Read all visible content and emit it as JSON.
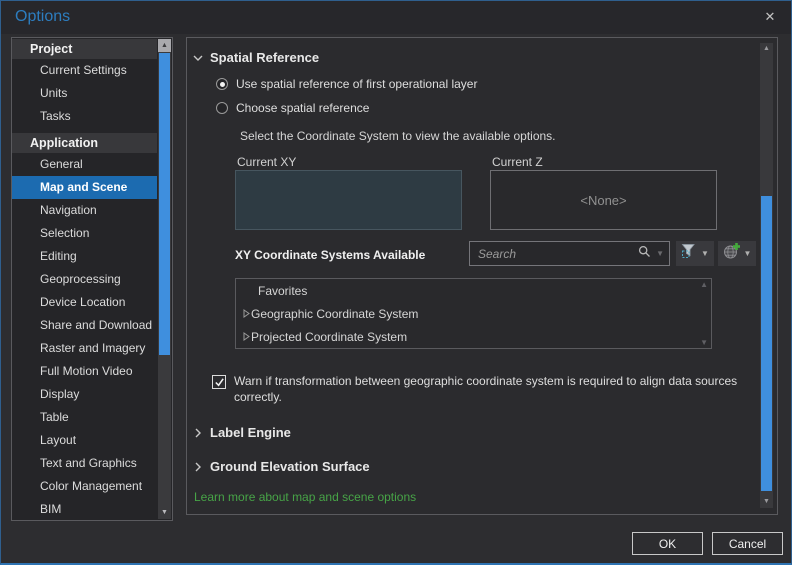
{
  "window": {
    "title": "Options",
    "ok_label": "OK",
    "cancel_label": "Cancel"
  },
  "icons": {
    "close": "✕",
    "scroll_up": "▲",
    "scroll_down": "▼",
    "dropdown": "▼"
  },
  "colors": {
    "selection_blue": "#1c6bb0",
    "scrollbar_blue": "#3f8fde",
    "title_blue": "#2d7dbf",
    "link_green": "#47a447",
    "current_xy_fill": "#2e3b43"
  },
  "sidebar": {
    "sections": [
      {
        "header": "Project",
        "items": [
          "Current Settings",
          "Units",
          "Tasks"
        ]
      },
      {
        "header": "Application",
        "selected_item": "Map and Scene",
        "items": [
          "General",
          "Map and Scene",
          "Navigation",
          "Selection",
          "Editing",
          "Geoprocessing",
          "Device Location",
          "Share and Download",
          "Raster and Imagery",
          "Full Motion Video",
          "Display",
          "Table",
          "Layout",
          "Text and Graphics",
          "Color Management",
          "BIM"
        ]
      }
    ]
  },
  "main": {
    "spatial_reference": {
      "title": "Spatial Reference",
      "use_first_layer": "Use spatial reference of first operational layer",
      "choose": "Choose spatial reference",
      "hint": "Select the Coordinate System to view the available options.",
      "current_xy_label": "Current XY",
      "current_z_label": "Current Z",
      "current_z_value": "<None>",
      "xy_available": "XY Coordinate Systems Available",
      "search_placeholder": "Search",
      "coordinate_list": [
        "Favorites",
        "Geographic Coordinate System",
        "Projected Coordinate System"
      ],
      "warn_checkbox": "Warn if transformation between geographic coordinate system is required to align data sources correctly.",
      "warn_checked": true
    },
    "collapsed_sections": [
      "Label Engine",
      "Ground Elevation Surface"
    ],
    "learn_more": "Learn more about map and scene options"
  }
}
